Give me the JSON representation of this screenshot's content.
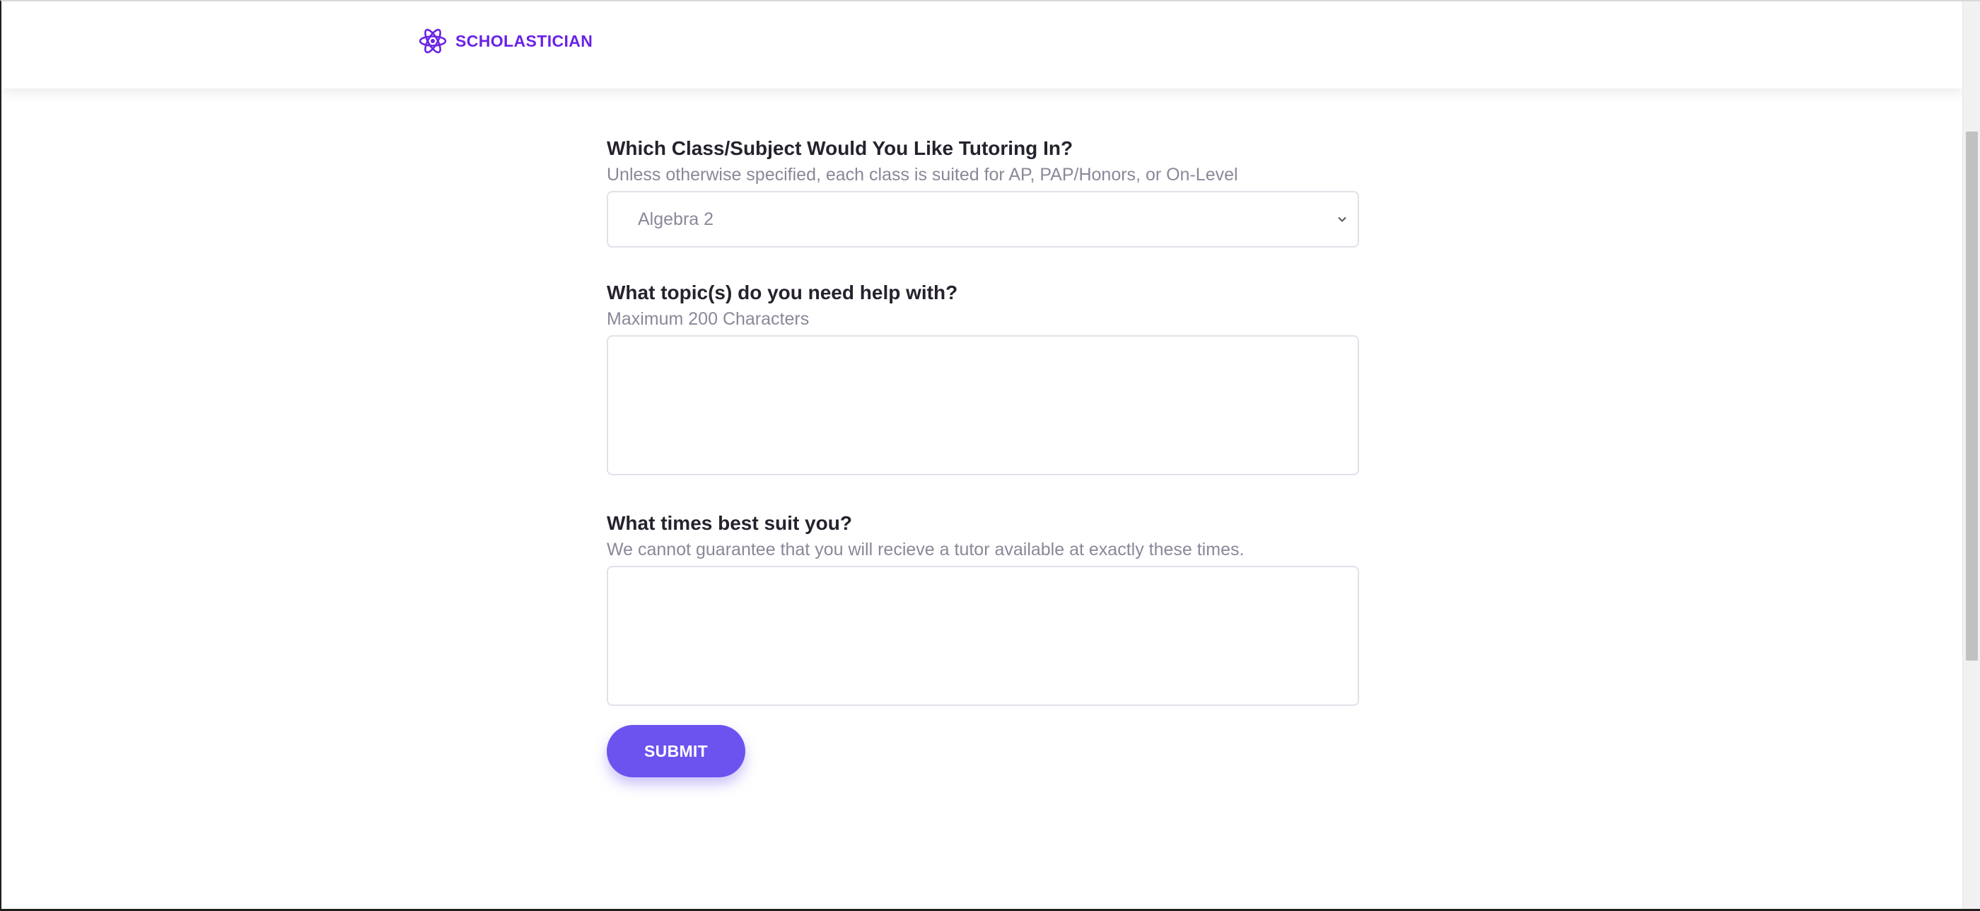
{
  "brand": {
    "name": "SCHOLASTICIAN",
    "color": "#6a22e6",
    "logo_icon": "atom-icon"
  },
  "form": {
    "subject": {
      "label": "Which Class/Subject Would You Like Tutoring In?",
      "hint": "Unless otherwise specified, each class is suited for AP, PAP/Honors, or On-Level",
      "selected_value": "Algebra 2"
    },
    "topics": {
      "label": "What topic(s) do you need help with?",
      "hint": "Maximum 200 Characters",
      "value": ""
    },
    "times": {
      "label": "What times best suit you?",
      "hint": "We cannot guarantee that you will recieve a tutor available at exactly these times.",
      "value": ""
    },
    "submit_label": "SUBMIT"
  },
  "colors": {
    "accent": "#6c53f0",
    "label_text": "#26222d",
    "hint_text": "#8a8898",
    "field_border": "#e2e1ea"
  },
  "scroll": {
    "visible_fraction": 0.58
  }
}
